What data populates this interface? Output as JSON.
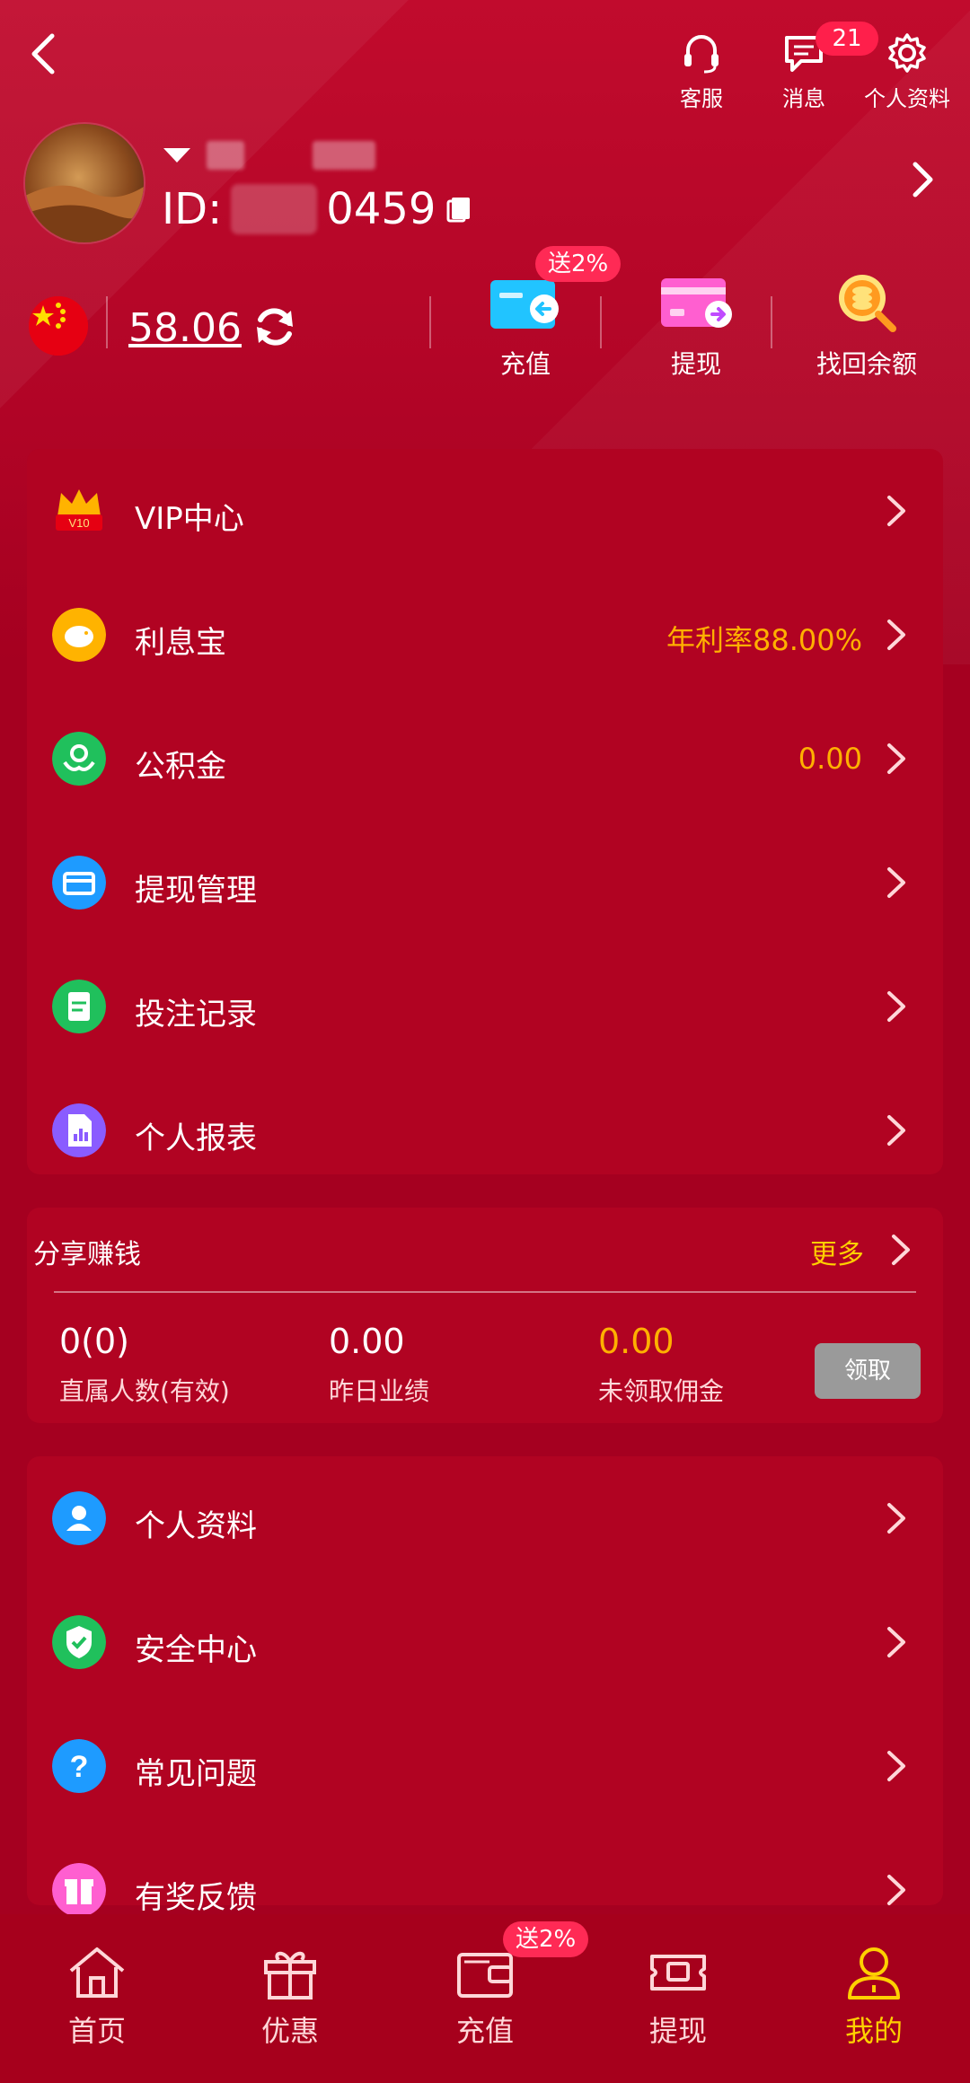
{
  "header": {
    "actions": [
      {
        "label": "客服",
        "icon": "headset-icon"
      },
      {
        "label": "消息",
        "icon": "message-icon",
        "badge": "21"
      },
      {
        "label": "个人资料",
        "icon": "gear-icon"
      }
    ]
  },
  "profile": {
    "id_prefix": "ID:",
    "id_suffix": "0459",
    "avatar": "desert-photo-avatar"
  },
  "wallet": {
    "balance": "58.06",
    "flag": "china-flag-icon",
    "quick_actions": [
      {
        "label": "充值",
        "badge": "送2%"
      },
      {
        "label": "提现"
      },
      {
        "label": "找回余额"
      }
    ]
  },
  "menu1": [
    {
      "label": "VIP中心",
      "value": "",
      "icon": "vip-crown-icon"
    },
    {
      "label": "利息宝",
      "value": "年利率88.00%",
      "icon": "piggy-bank-icon"
    },
    {
      "label": "公积金",
      "value": "0.00",
      "icon": "fund-icon"
    },
    {
      "label": "提现管理",
      "value": "",
      "icon": "card-icon"
    },
    {
      "label": "投注记录",
      "value": "",
      "icon": "record-icon"
    },
    {
      "label": "个人报表",
      "value": "",
      "icon": "report-icon"
    }
  ],
  "share": {
    "title": "分享赚钱",
    "more": "更多",
    "stats": [
      {
        "value": "0(0)",
        "label": "直属人数(有效)"
      },
      {
        "value": "0.00",
        "label": "昨日业绩"
      },
      {
        "value": "0.00",
        "label": "未领取佣金"
      }
    ],
    "claim": "领取"
  },
  "menu2": [
    {
      "label": "个人资料",
      "icon": "user-icon"
    },
    {
      "label": "安全中心",
      "icon": "shield-icon"
    },
    {
      "label": "常见问题",
      "icon": "question-icon"
    },
    {
      "label": "有奖反馈",
      "icon": "gift-icon"
    }
  ],
  "bottom_nav": [
    {
      "label": "首页",
      "icon": "home-icon"
    },
    {
      "label": "优惠",
      "icon": "gift-box-icon"
    },
    {
      "label": "充值",
      "icon": "wallet-icon",
      "badge": "送2%"
    },
    {
      "label": "提现",
      "icon": "cash-icon"
    },
    {
      "label": "我的",
      "icon": "person-icon",
      "active": true
    }
  ],
  "colors": {
    "bg": "#a50020",
    "accent_yellow": "#ffcf00",
    "badge_pink": "#ff2a55",
    "orange": "#ffb000"
  }
}
